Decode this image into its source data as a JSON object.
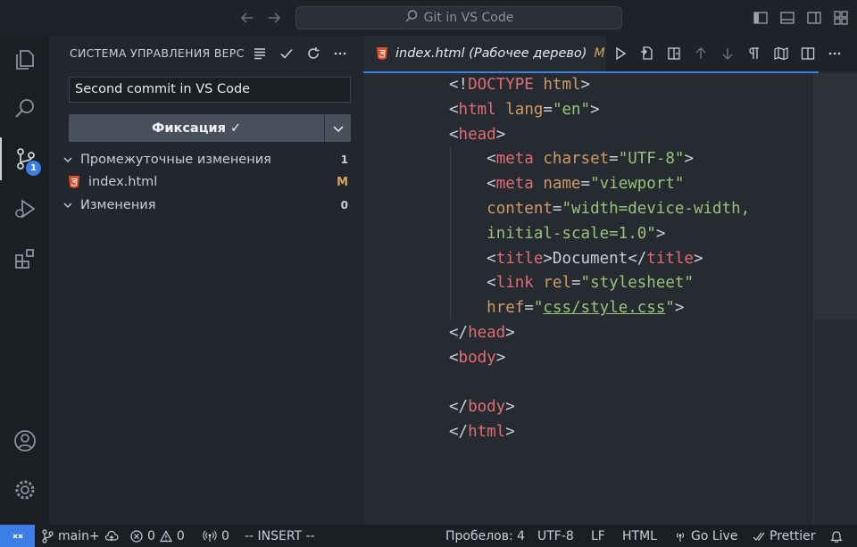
{
  "titlebar": {
    "search_label": "Git in VS Code",
    "icons": [
      "arrow-left-icon",
      "arrow-right-icon",
      "search-icon",
      "toggle-primary-sidebar-icon",
      "toggle-panel-icon",
      "toggle-secondary-sidebar-icon",
      "customize-layout-icon"
    ]
  },
  "activity": {
    "items": [
      "explorer-icon",
      "search-icon",
      "source-control-icon",
      "run-debug-icon",
      "extensions-icon"
    ],
    "scm_badge": "1",
    "bottom": [
      "accounts-icon",
      "manage-gear-icon"
    ]
  },
  "sidebar": {
    "title": "СИСТЕМА УПРАВЛЕНИЯ ВЕРСИЯМИ",
    "commit_message": "Second commit in VS Code",
    "commit_button": "Фиксация ✓",
    "staged_label": "Промежуточные изменения",
    "staged_count": "1",
    "file_name": "index.html",
    "file_status": "M",
    "changes_label": "Изменения",
    "changes_count": "0"
  },
  "editor": {
    "tab_title": "index.html (Рабочее дерево)",
    "tab_status": "M",
    "code_lines": [
      [
        [
          "br",
          "<!"
        ],
        [
          "tag",
          "DOCTYPE"
        ],
        [
          "br",
          " "
        ],
        [
          "attr",
          "html"
        ],
        [
          "br",
          ">"
        ]
      ],
      [
        [
          "br",
          "<"
        ],
        [
          "tag",
          "html"
        ],
        [
          "br",
          " "
        ],
        [
          "attr",
          "lang"
        ],
        [
          "br",
          "="
        ],
        [
          "str",
          "\"en\""
        ],
        [
          "br",
          ">"
        ]
      ],
      [
        [
          "br",
          "<"
        ],
        [
          "tag",
          "head"
        ],
        [
          "br",
          ">"
        ]
      ],
      [
        [
          "br",
          "    <"
        ],
        [
          "tag",
          "meta"
        ],
        [
          "br",
          " "
        ],
        [
          "attr",
          "charset"
        ],
        [
          "br",
          "="
        ],
        [
          "str",
          "\"UTF-8\""
        ],
        [
          "br",
          ">"
        ]
      ],
      [
        [
          "br",
          "    <"
        ],
        [
          "tag",
          "meta"
        ],
        [
          "br",
          " "
        ],
        [
          "attr",
          "name"
        ],
        [
          "br",
          "="
        ],
        [
          "str",
          "\"viewport\""
        ]
      ],
      [
        [
          "br",
          "    "
        ],
        [
          "attr",
          "content"
        ],
        [
          "br",
          "="
        ],
        [
          "str",
          "\"width=device-width,"
        ]
      ],
      [
        [
          "br",
          "    "
        ],
        [
          "str",
          "initial-scale=1.0\""
        ],
        [
          "br",
          ">"
        ]
      ],
      [
        [
          "br",
          "    <"
        ],
        [
          "tag",
          "title"
        ],
        [
          "br",
          ">Document</"
        ],
        [
          "tag",
          "title"
        ],
        [
          "br",
          ">"
        ]
      ],
      [
        [
          "br",
          "    <"
        ],
        [
          "tag",
          "link"
        ],
        [
          "br",
          " "
        ],
        [
          "attr",
          "rel"
        ],
        [
          "br",
          "="
        ],
        [
          "str",
          "\"stylesheet\""
        ]
      ],
      [
        [
          "br",
          "    "
        ],
        [
          "attr",
          "href"
        ],
        [
          "br",
          "="
        ],
        [
          "str",
          "\""
        ],
        [
          "stru",
          "css/style.css"
        ],
        [
          "str",
          "\""
        ],
        [
          "br",
          ">"
        ]
      ],
      [
        [
          "br",
          "</"
        ],
        [
          "tag",
          "head"
        ],
        [
          "br",
          ">"
        ]
      ],
      [
        [
          "br",
          "<"
        ],
        [
          "tag",
          "body"
        ],
        [
          "br",
          ">"
        ]
      ],
      [
        [
          "br",
          ""
        ]
      ],
      [
        [
          "br",
          "</"
        ],
        [
          "tag",
          "body"
        ],
        [
          "br",
          ">"
        ]
      ],
      [
        [
          "br",
          "</"
        ],
        [
          "tag",
          "html"
        ],
        [
          "br",
          ">"
        ]
      ]
    ]
  },
  "statusbar": {
    "branch": "main+",
    "errors": "0",
    "warnings": "0",
    "ports": "0",
    "mode": "-- INSERT --",
    "spaces": "Пробелов: 4",
    "encoding": "UTF-8",
    "eol": "LF",
    "language": "HTML",
    "go_live": "Go Live",
    "prettier": "Prettier"
  }
}
